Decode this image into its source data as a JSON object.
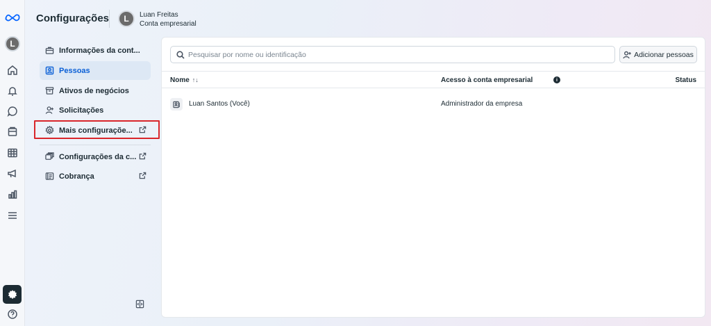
{
  "header": {
    "title": "Configurações",
    "avatar_initial": "L",
    "user_name": "Luan Freitas",
    "account_type": "Conta empresarial"
  },
  "rail": {
    "avatar_initial": "L",
    "icons": [
      "meta-logo-icon",
      "home-icon",
      "bell-icon",
      "chat-icon",
      "pages-icon",
      "table-icon",
      "megaphone-icon",
      "bar-chart-icon",
      "menu-icon",
      "gear-icon",
      "help-icon"
    ]
  },
  "sidebar": {
    "items": [
      {
        "label": "Informações da cont...",
        "icon": "briefcase-icon"
      },
      {
        "label": "Pessoas",
        "icon": "people-icon",
        "active": true
      },
      {
        "label": "Ativos de negócios",
        "icon": "box-icon"
      },
      {
        "label": "Solicitações",
        "icon": "person-add-icon"
      },
      {
        "label": "Mais configuraçõe...",
        "icon": "gear-icon",
        "external": true,
        "highlighted": true
      },
      {
        "label": "Configurações da c...",
        "icon": "stack-icon",
        "external": true
      },
      {
        "label": "Cobrança",
        "icon": "receipt-icon",
        "external": true
      }
    ]
  },
  "main": {
    "search_placeholder": "Pesquisar por nome ou identificação",
    "add_button_label": "Adicionar pessoas",
    "table": {
      "columns": [
        "Nome",
        "Acesso à conta empresarial",
        "Status"
      ],
      "sort_indicator": "↑↓",
      "info_glyph": "i",
      "rows": [
        {
          "name": "Luan Santos (Você)",
          "access": "Administrador da empresa",
          "status": ""
        }
      ]
    }
  },
  "colors": {
    "accent": "#0a5fd6",
    "highlight_border": "#d9262b",
    "meta_blue": "#0866ff"
  }
}
